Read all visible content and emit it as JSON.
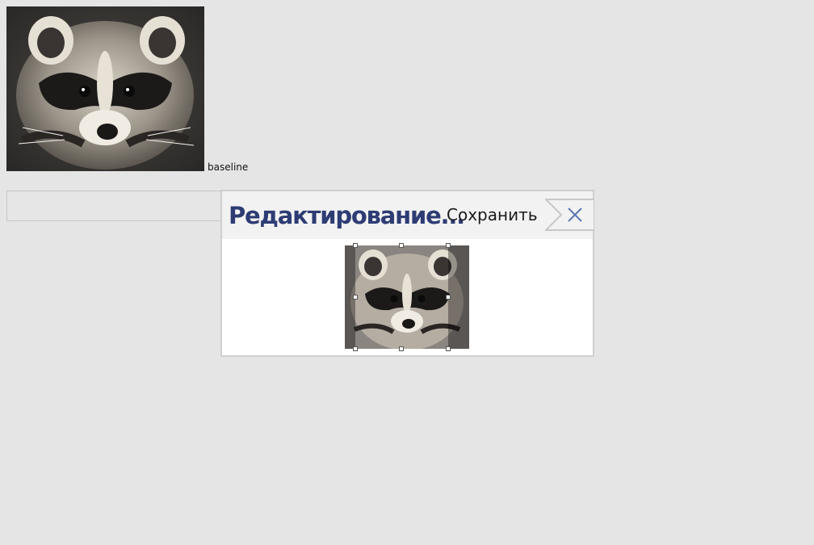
{
  "main": {
    "image_alt": "raccoon",
    "baseline_label": "baseline",
    "text_field_value": ""
  },
  "editor": {
    "title": "Редактирование...",
    "save_label": "Сохранить",
    "close_icon": "close-icon",
    "preview_alt": "raccoon"
  },
  "colors": {
    "background": "#e5e5e5",
    "title": "#2e3c74",
    "close_icon": "#5b78b0",
    "header": "#f2f2f2"
  }
}
